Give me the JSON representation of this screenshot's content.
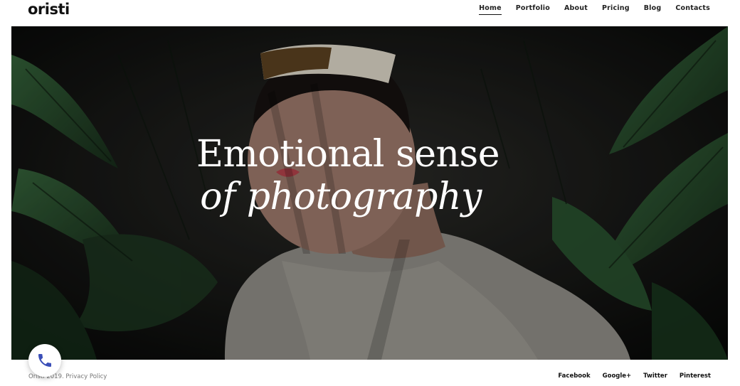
{
  "header": {
    "logo": "oristi",
    "nav": [
      {
        "label": "Home",
        "active": true
      },
      {
        "label": "Portfolio"
      },
      {
        "label": "About"
      },
      {
        "label": "Pricing"
      },
      {
        "label": "Blog"
      },
      {
        "label": "Contacts"
      }
    ]
  },
  "hero": {
    "title_line1": "Emotional sense",
    "title_line2": "of photography"
  },
  "footer": {
    "copyright": "Oristi 2019. Privacy Policy",
    "social": [
      "Facebook",
      "Google+",
      "Twitter",
      "Pinterest"
    ]
  },
  "call_button": {
    "icon": "phone-icon",
    "color": "#3b4fb8"
  },
  "colors": {
    "text": "#111111",
    "hero_bg": "#0c0e0c",
    "foliage": "#2f5a36"
  }
}
